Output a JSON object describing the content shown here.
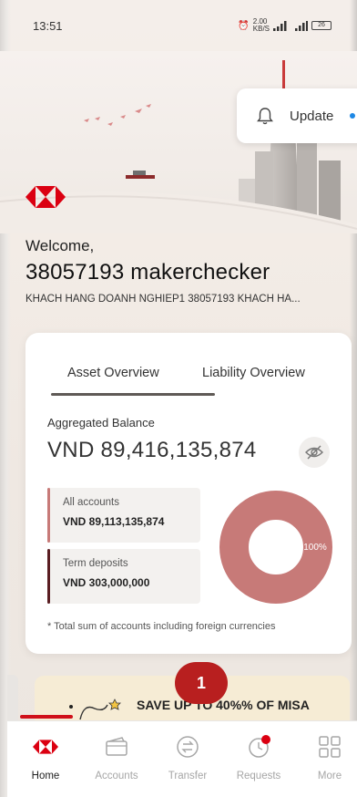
{
  "status_bar": {
    "time": "13:51",
    "network_speed": "2.00\nKB/S",
    "battery": "26"
  },
  "update_button": {
    "label": "Update"
  },
  "welcome": {
    "greeting": "Welcome,",
    "user_name": "38057193 makerchecker",
    "company": "KHACH HANG DOANH NGHIEP1 38057193 KHACH HA..."
  },
  "overview": {
    "tabs": [
      "Asset Overview",
      "Liability Overview"
    ],
    "active_tab": "Asset Overview",
    "aggregated_label": "Aggregated Balance",
    "aggregated_value": "VND 89,416,135,874",
    "accounts": [
      {
        "label": "All accounts",
        "value": "VND 89,113,135,874",
        "color": "#c77a78"
      },
      {
        "label": "Term deposits",
        "value": "VND 303,000,000",
        "color": "#5a1e22"
      }
    ],
    "donut_label": "100%",
    "donut_share": 1.0,
    "donut_color": "#c77a78",
    "footnote": "* Total sum of accounts including foreign currencies"
  },
  "promo": {
    "text": "SAVE UP TO 40%% OF MISA"
  },
  "step_badge": "1",
  "bottom_nav": {
    "items": [
      {
        "label": "Home",
        "icon": "hsbc-logo-icon",
        "active": true
      },
      {
        "label": "Accounts",
        "icon": "wallet-icon",
        "active": false
      },
      {
        "label": "Transfer",
        "icon": "transfer-icon",
        "active": false
      },
      {
        "label": "Requests",
        "icon": "clock-icon",
        "active": false
      },
      {
        "label": "More",
        "icon": "grid-icon",
        "active": false
      }
    ]
  },
  "colors": {
    "brand_red": "#db0011",
    "badge_red": "#b81f1f",
    "promo_bg": "#f6ecd5"
  }
}
